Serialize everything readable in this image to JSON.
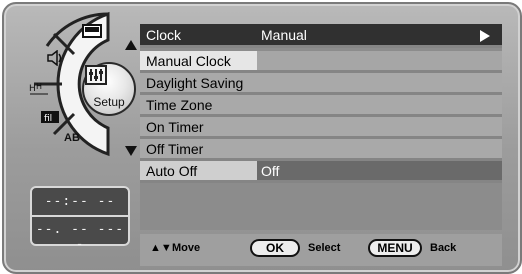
{
  "menu": {
    "header": {
      "label": "Clock",
      "value": "Manual"
    },
    "items": [
      {
        "label": "Manual Clock"
      },
      {
        "label": "Daylight Saving"
      },
      {
        "label": "Time Zone"
      },
      {
        "label": "On Timer"
      },
      {
        "label": "Off Timer"
      },
      {
        "label": "Auto Off",
        "value": "Off"
      }
    ]
  },
  "dial": {
    "setup_label": "Setup",
    "ab_label": "AB"
  },
  "lcd": {
    "line1": "--:-- --",
    "line2": "--. -- ----"
  },
  "footer": {
    "move_label": "Move",
    "ok_label": "OK",
    "select_label": "Select",
    "menu_label": "MENU",
    "back_label": "Back"
  },
  "colors": {
    "header_bg": "#303030",
    "selected_bg": "#e6e6e6",
    "item_bg": "#a9a9a9"
  }
}
